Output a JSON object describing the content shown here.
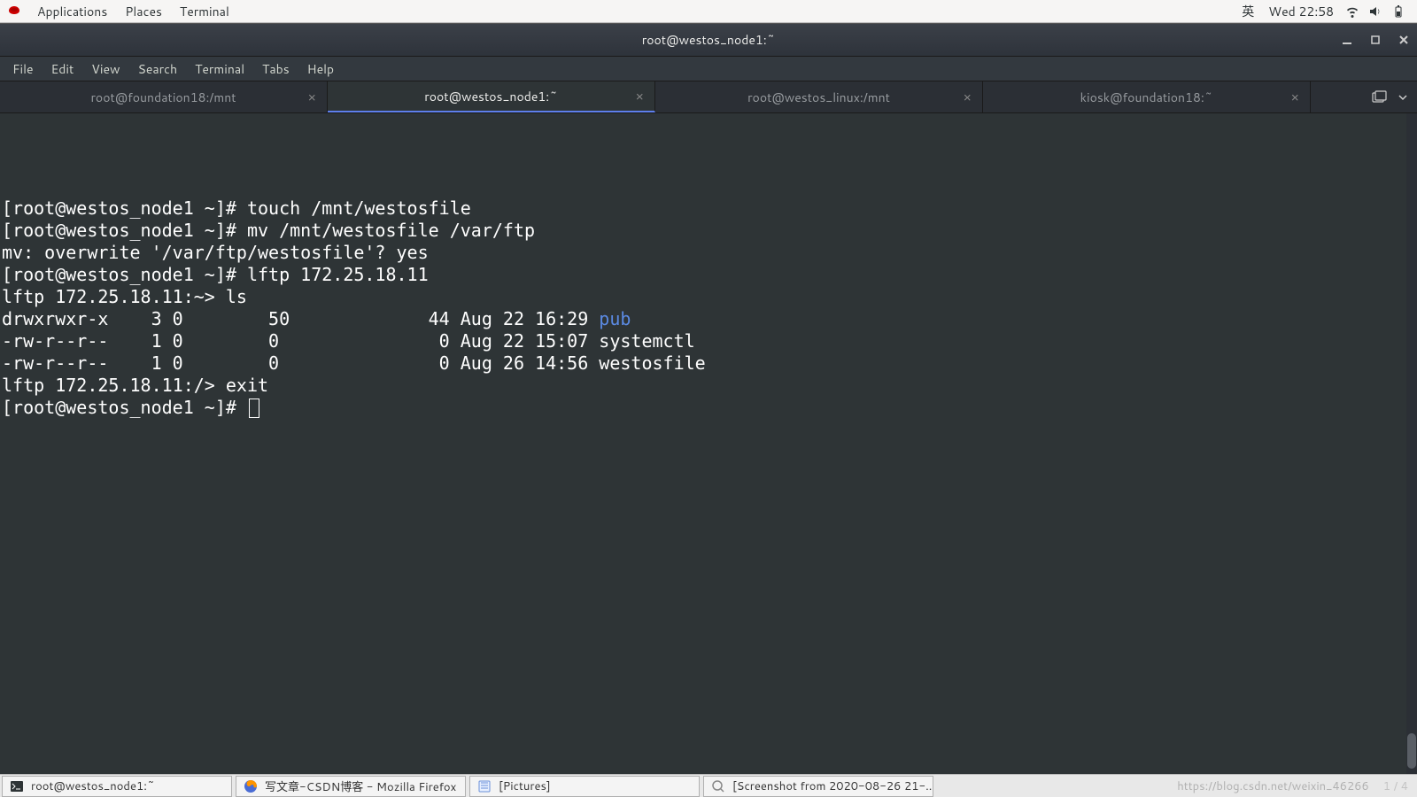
{
  "top_panel": {
    "applications": "Applications",
    "places": "Places",
    "terminal": "Terminal",
    "ime": "英",
    "clock": "Wed 22:58"
  },
  "titlebar": {
    "title": "root@westos_node1:~"
  },
  "menubar": {
    "file": "File",
    "edit": "Edit",
    "view": "View",
    "search": "Search",
    "terminal": "Terminal",
    "tabs": "Tabs",
    "help": "Help"
  },
  "tabs": [
    {
      "label": "root@foundation18:/mnt",
      "active": false
    },
    {
      "label": "root@westos_node1:~",
      "active": true
    },
    {
      "label": "root@westos_linux:/mnt",
      "active": false
    },
    {
      "label": "kiosk@foundation18:~",
      "active": false
    }
  ],
  "terminal": {
    "line1": "[root@westos_node1 ~]# touch /mnt/westosfile",
    "line2": "[root@westos_node1 ~]# mv /mnt/westosfile /var/ftp",
    "line3": "mv: overwrite '/var/ftp/westosfile'? yes",
    "line4": "[root@westos_node1 ~]# lftp 172.25.18.11",
    "line5": "lftp 172.25.18.11:~> ls",
    "line6a": "drwxrwxr-x    3 0        50             44 Aug 22 16:29 ",
    "line6b": "pub",
    "line7": "-rw-r--r--    1 0        0               0 Aug 22 15:07 systemctl",
    "line8": "-rw-r--r--    1 0        0               0 Aug 26 14:56 westosfile",
    "line9": "lftp 172.25.18.11:/> exit",
    "line10": "[root@westos_node1 ~]# "
  },
  "taskbar": {
    "items": [
      {
        "label": "root@westos_node1:~"
      },
      {
        "label": "写文章-CSDN博客 - Mozilla Firefox"
      },
      {
        "label": "[Pictures]"
      },
      {
        "label": "[Screenshot from 2020-08-26 21-..."
      }
    ],
    "watermark": "https://blog.csdn.net/weixin_46266",
    "page": "1 / 4"
  }
}
